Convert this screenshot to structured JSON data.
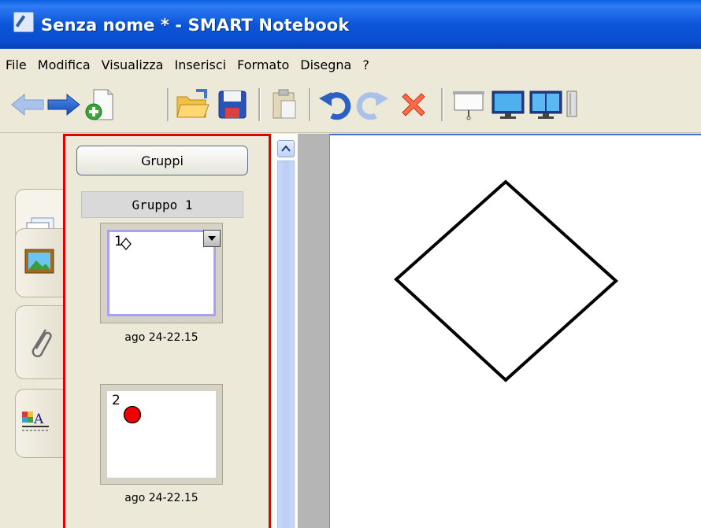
{
  "window": {
    "title": "Senza nome * - SMART Notebook"
  },
  "menu": [
    "File",
    "Modifica",
    "Visualizza",
    "Inserisci",
    "Formato",
    "Disegna",
    "?"
  ],
  "toolbar": {
    "buttons": [
      "back-icon",
      "forward-icon",
      "add-page-icon",
      "open-folder-icon",
      "save-icon",
      "paste-icon",
      "undo-icon",
      "redo-icon",
      "delete-icon",
      "screen-shade-icon",
      "full-screen-icon",
      "dual-page-icon",
      "more-icon"
    ]
  },
  "sidebar_tabs": [
    "page-sorter-icon",
    "gallery-icon",
    "attachments-icon",
    "properties-icon"
  ],
  "sorter": {
    "groups_button": "Gruppi",
    "group_label": "Gruppo 1",
    "pages": [
      {
        "number": "1",
        "caption": "ago 24-22.15",
        "selected": true
      },
      {
        "number": "2",
        "caption": "ago 24-22.15",
        "selected": false
      }
    ]
  },
  "colors": {
    "highlight_border": "#e10000",
    "title_bar": "#0a56d8",
    "red_dot": "#ee0000"
  }
}
